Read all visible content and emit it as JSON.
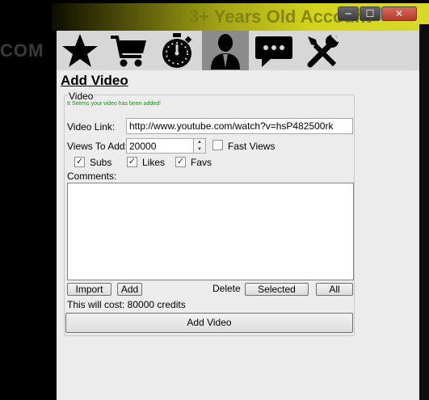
{
  "background": {
    "left_text": "COM",
    "banner_text": "3+ Years Old Account"
  },
  "window_controls": {
    "minimize": "─",
    "maximize": "☐",
    "close": "✕"
  },
  "toolbar": {
    "tools": [
      {
        "name": "favorites",
        "icon": "star-icon"
      },
      {
        "name": "cart",
        "icon": "cart-icon"
      },
      {
        "name": "timer",
        "icon": "stopwatch-icon"
      },
      {
        "name": "account",
        "icon": "user-icon",
        "active": true
      },
      {
        "name": "messages",
        "icon": "chat-icon"
      },
      {
        "name": "tools",
        "icon": "tools-icon"
      }
    ],
    "active_color": "#8b8b8b"
  },
  "page": {
    "title": "Add Video"
  },
  "video_group": {
    "legend": "Video",
    "status": "It Seems your video has been added!",
    "status_color": "#1c8f1c",
    "video_link_label": "Video Link:",
    "video_link_value": "http://www.youtube.com/watch?v=hsP482500rk",
    "views_label": "Views To Add:",
    "views_value": "20000",
    "fast_views_label": "Fast Views",
    "fast_views_checked": false,
    "subs_label": "Subs",
    "subs_checked": true,
    "likes_label": "Likes",
    "likes_checked": true,
    "favs_label": "Favs",
    "favs_checked": true,
    "comments_label": "Comments:",
    "comments_value": "",
    "import_button": "Import",
    "add_button": "Add",
    "delete_label": "Delete",
    "selected_button": "Selected",
    "all_button": "All",
    "cost_text": "This will cost: 80000 credits",
    "submit_button": "Add Video"
  }
}
